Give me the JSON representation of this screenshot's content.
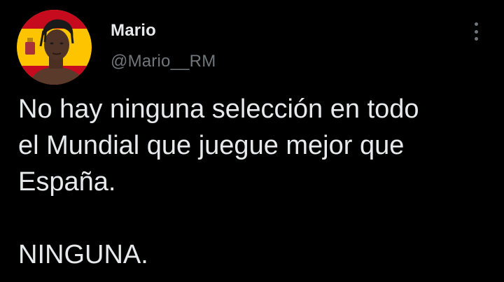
{
  "author": {
    "display_name": "Mario",
    "handle": "@Mario__RM",
    "avatar_icon": "profile-photo-spain-flag"
  },
  "tweet": {
    "text": "No hay ninguna selección en todo\nel Mundial que juegue mejor que\nEspaña.\n\nNINGUNA."
  },
  "menu": {
    "icon": "more-vertical-icon"
  },
  "colors": {
    "background": "#000000",
    "text": "#e7e9ea",
    "secondary_text": "#71767b",
    "flag_red": "#c60b1e",
    "flag_yellow": "#ffc400"
  }
}
